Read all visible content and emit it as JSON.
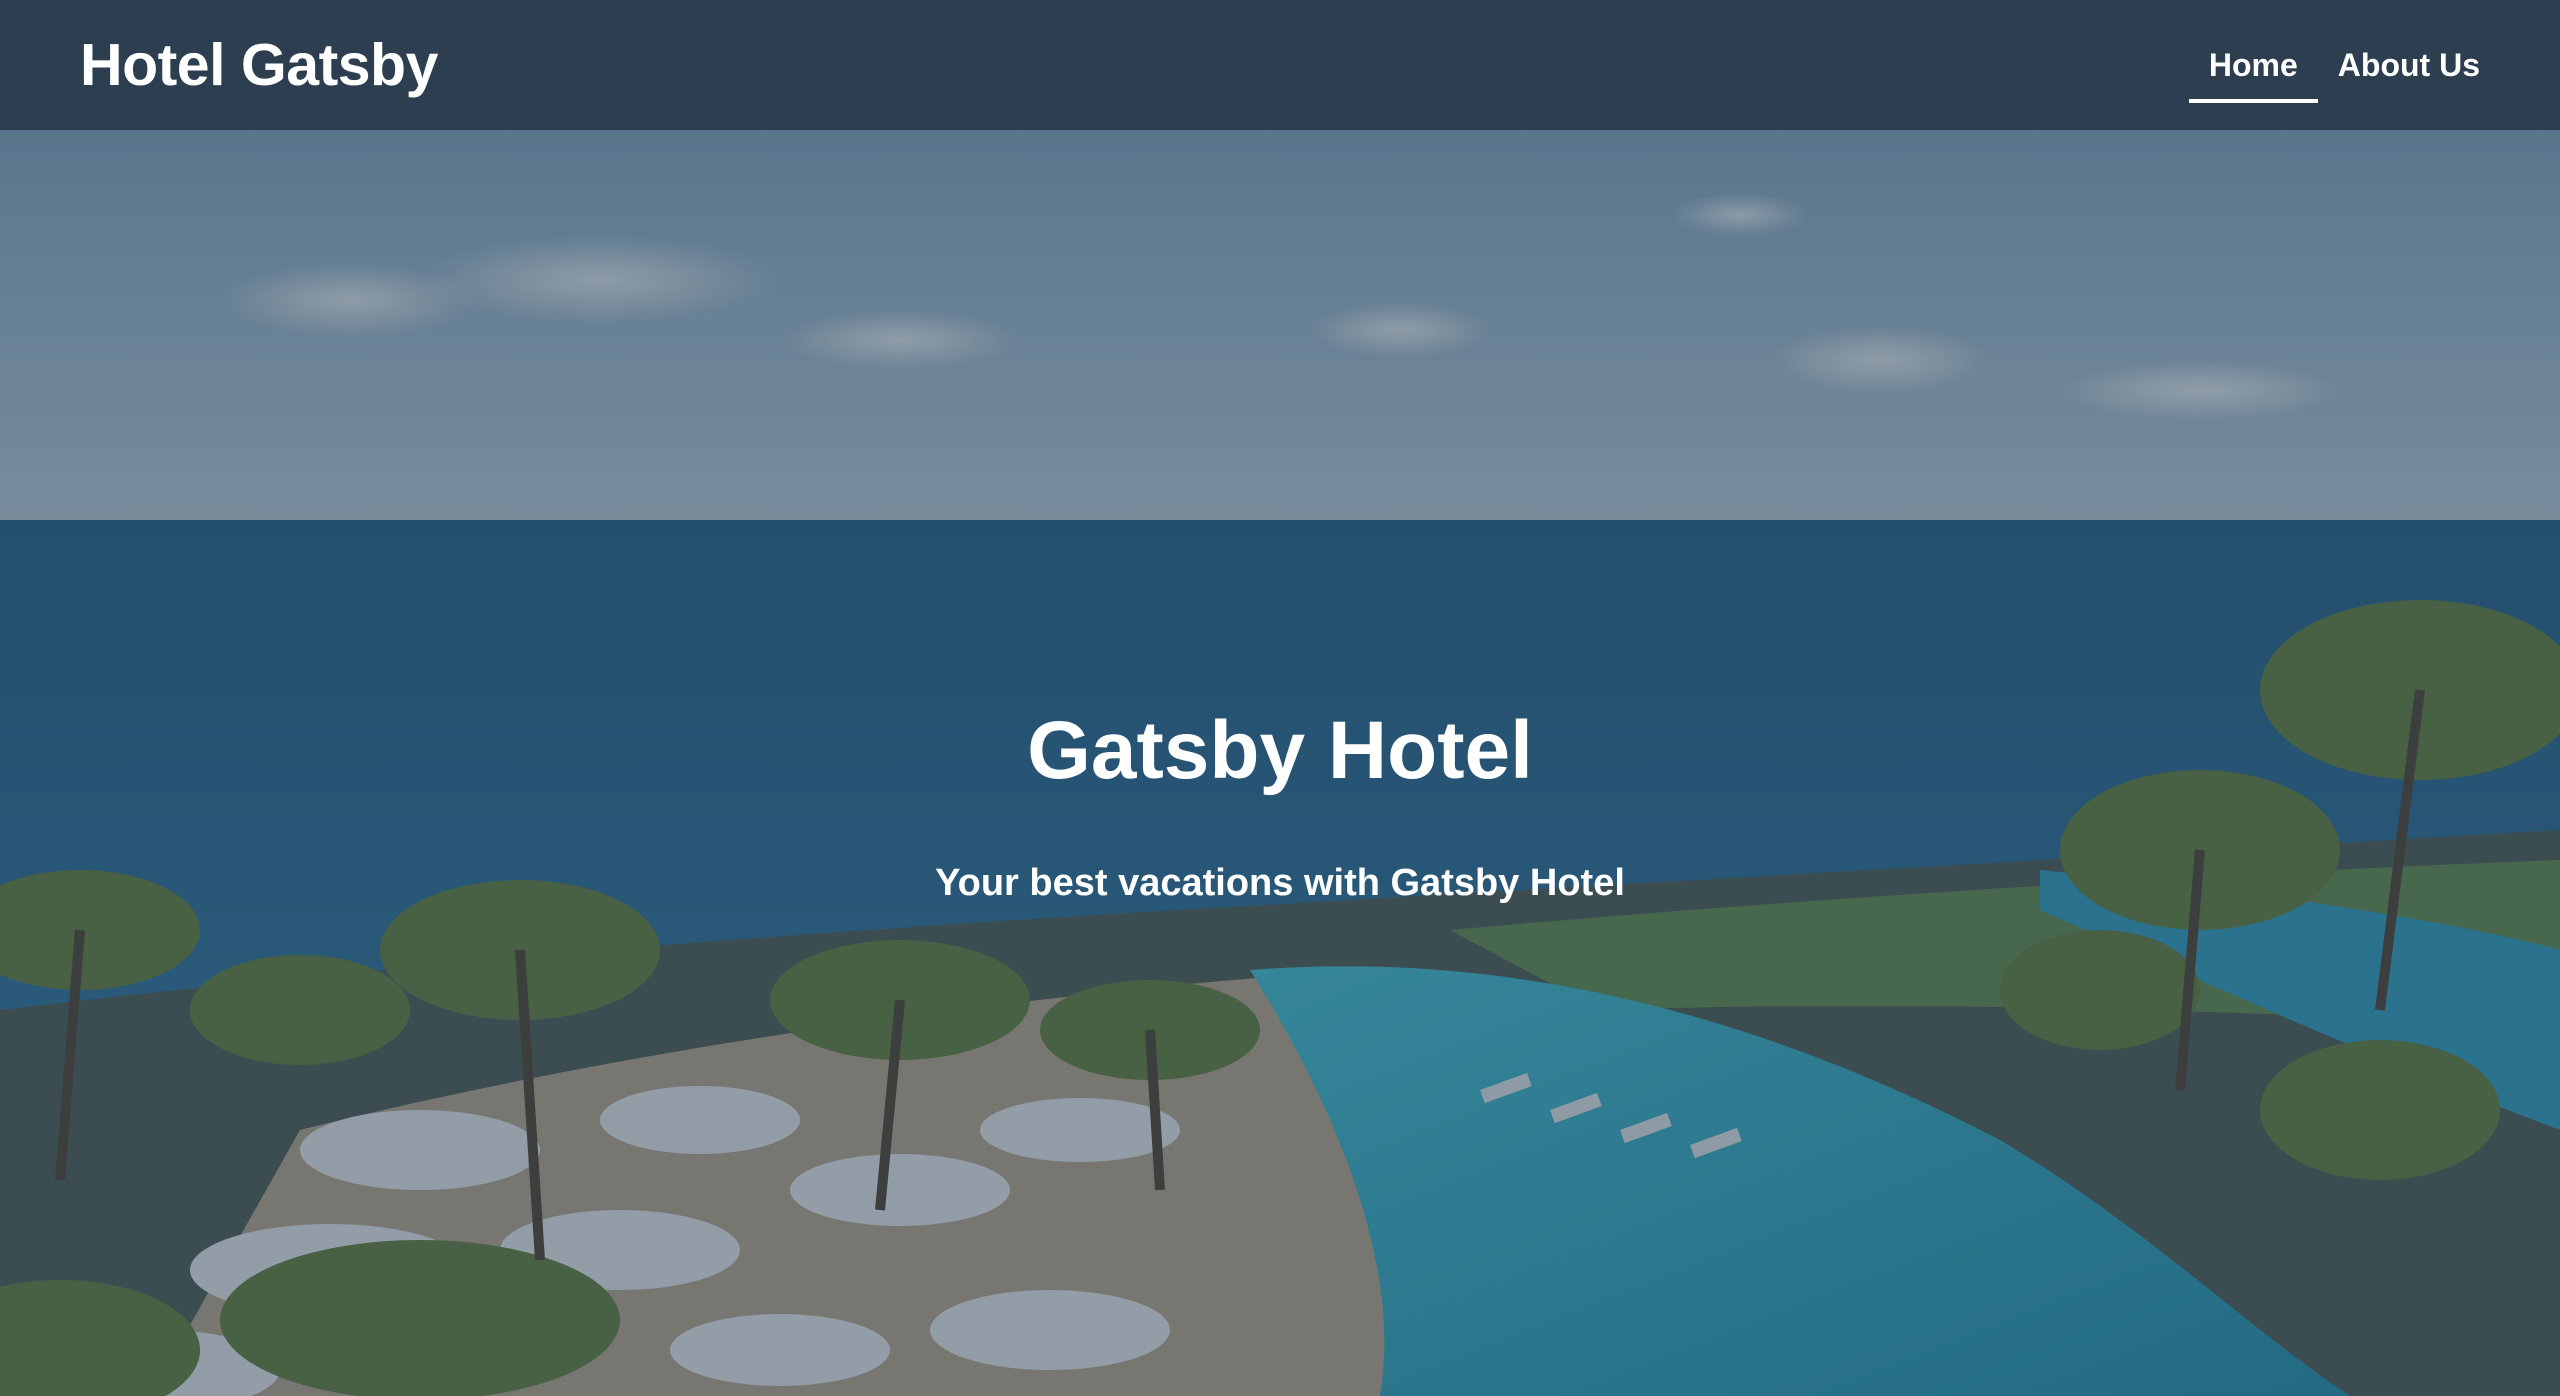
{
  "header": {
    "site_title": "Hotel Gatsby",
    "nav": [
      {
        "label": "Home",
        "active": true
      },
      {
        "label": "About Us",
        "active": false
      }
    ]
  },
  "hero": {
    "title": "Gatsby Hotel",
    "subtitle": "Your best vacations with Gatsby Hotel",
    "image": "resort-pool-ocean-palm-trees-photo"
  },
  "colors": {
    "header_bg": "#2d3e50",
    "text": "#ffffff",
    "overlay": "rgba(44,62,80,0.45)"
  }
}
